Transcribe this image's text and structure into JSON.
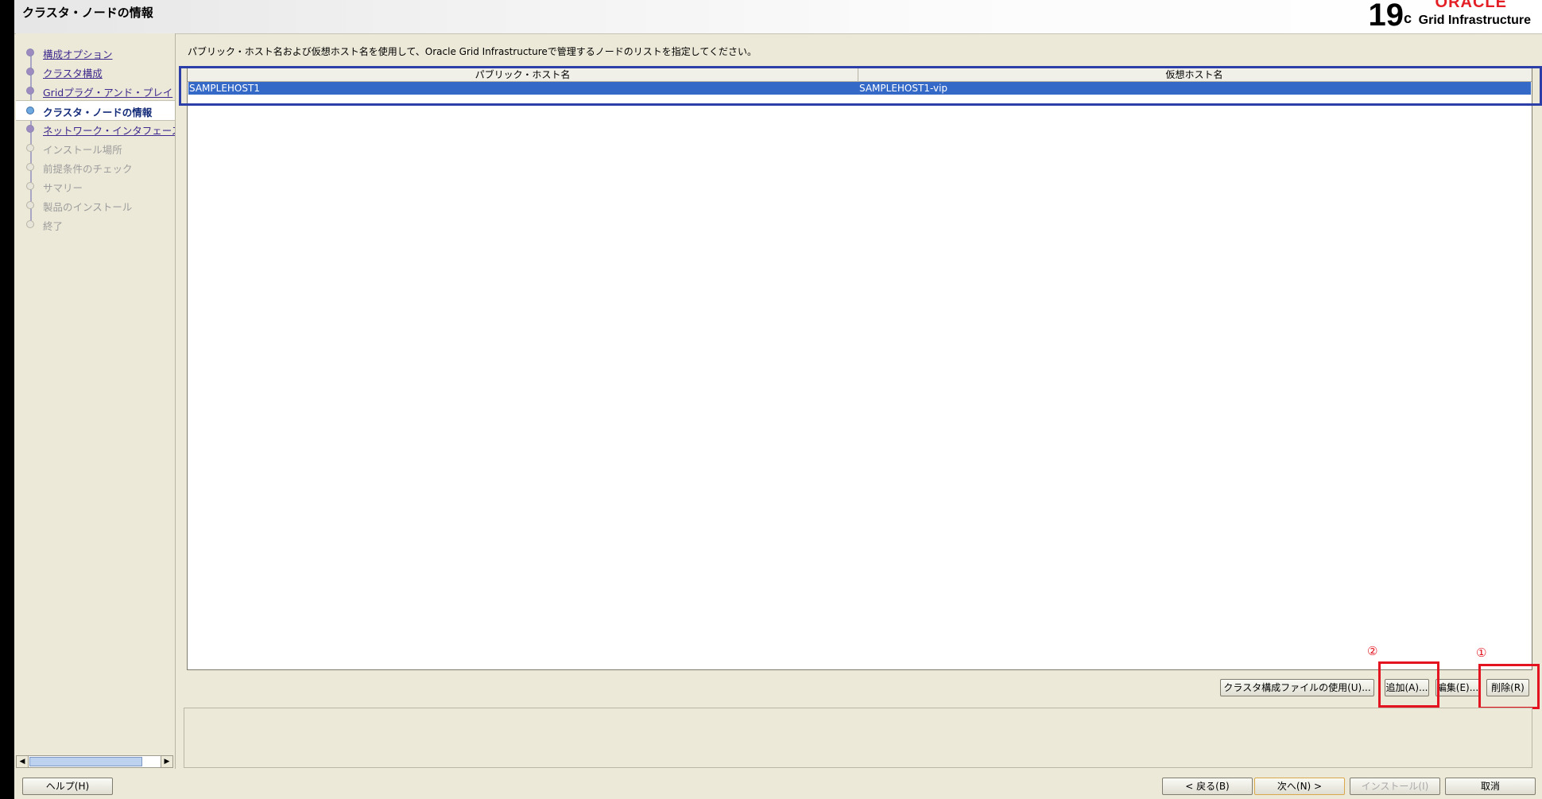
{
  "header": {
    "title": "クラスタ・ノードの情報",
    "brand_version": "19",
    "brand_version_sup": "c",
    "brand_oracle": "ORACLE",
    "brand_product": "Grid Infrastructure"
  },
  "nav": {
    "items": [
      {
        "label": "構成オプション",
        "state": "done"
      },
      {
        "label": "クラスタ構成",
        "state": "done"
      },
      {
        "label": "Gridプラグ・アンド・プレイ",
        "state": "done"
      },
      {
        "label": "クラスタ・ノードの情報",
        "state": "current"
      },
      {
        "label": "ネットワーク・インタフェース",
        "state": "done"
      },
      {
        "label": "インストール場所",
        "state": "pending"
      },
      {
        "label": "前提条件のチェック",
        "state": "pending"
      },
      {
        "label": "サマリー",
        "state": "pending"
      },
      {
        "label": "製品のインストール",
        "state": "pending"
      },
      {
        "label": "終了",
        "state": "pending"
      }
    ]
  },
  "main": {
    "instruction": "パブリック・ホスト名および仮想ホスト名を使用して、Oracle Grid Infrastructureで管理するノードのリストを指定してください。",
    "table": {
      "columns": [
        "パブリック・ホスト名",
        "仮想ホスト名"
      ],
      "rows": [
        [
          "SAMPLEHOST1",
          "SAMPLEHOST1-vip"
        ]
      ]
    },
    "buttons": {
      "use_cluster_file": "クラスタ構成ファイルの使用(U)...",
      "add": "追加(A)...",
      "edit": "編集(E)...",
      "delete": "削除(R)"
    },
    "markers": {
      "first": "①",
      "second": "②"
    }
  },
  "footer": {
    "help": "ヘルプ(H)",
    "back": "< 戻る(B)",
    "next": "次へ(N) >",
    "install": "インストール(I)",
    "cancel": "取消"
  }
}
